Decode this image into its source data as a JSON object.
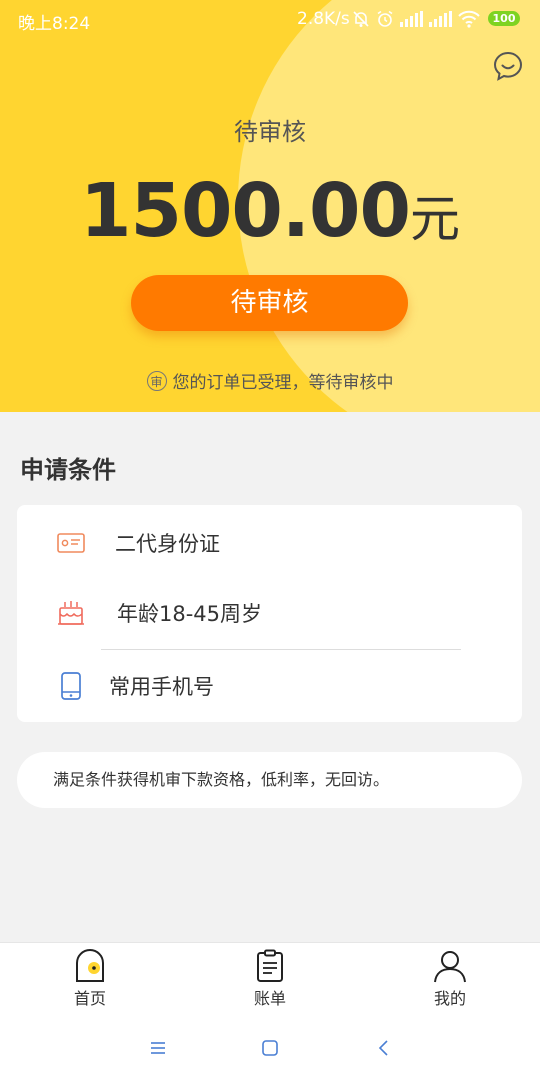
{
  "status_bar": {
    "time": "晚上8:24",
    "net_speed": "2.8K/s",
    "battery": "100",
    "icons": [
      "silent-bell-icon",
      "alarm-icon",
      "signal-icon",
      "hd-signal-icon",
      "wifi-icon",
      "battery-icon"
    ]
  },
  "hero": {
    "title": "待审核",
    "amount": "1500.00",
    "unit": "元",
    "button_label": "待审核",
    "notice_icon_text": "审",
    "notice_text": "您的订单已受理，等待审核中"
  },
  "conditions": {
    "title": "申请条件",
    "items": [
      {
        "icon": "id-card-icon",
        "label": "二代身份证"
      },
      {
        "icon": "birthday-cake-icon",
        "label": "年龄18-45周岁"
      },
      {
        "icon": "mobile-phone-icon",
        "label": "常用手机号"
      }
    ]
  },
  "tip": {
    "text": "满足条件获得机审下款资格，低利率，无回访。"
  },
  "tabs": [
    {
      "label": "首页",
      "icon": "home-icon"
    },
    {
      "label": "账单",
      "icon": "bill-icon"
    },
    {
      "label": "我的",
      "icon": "profile-icon"
    }
  ],
  "nav": [
    "menu-icon",
    "home-square-icon",
    "back-icon"
  ],
  "colors": {
    "hero_bg": "#ffd530",
    "hero_circle": "#ffe67a",
    "button": "#ff7a00",
    "battery": "#7ed321"
  }
}
